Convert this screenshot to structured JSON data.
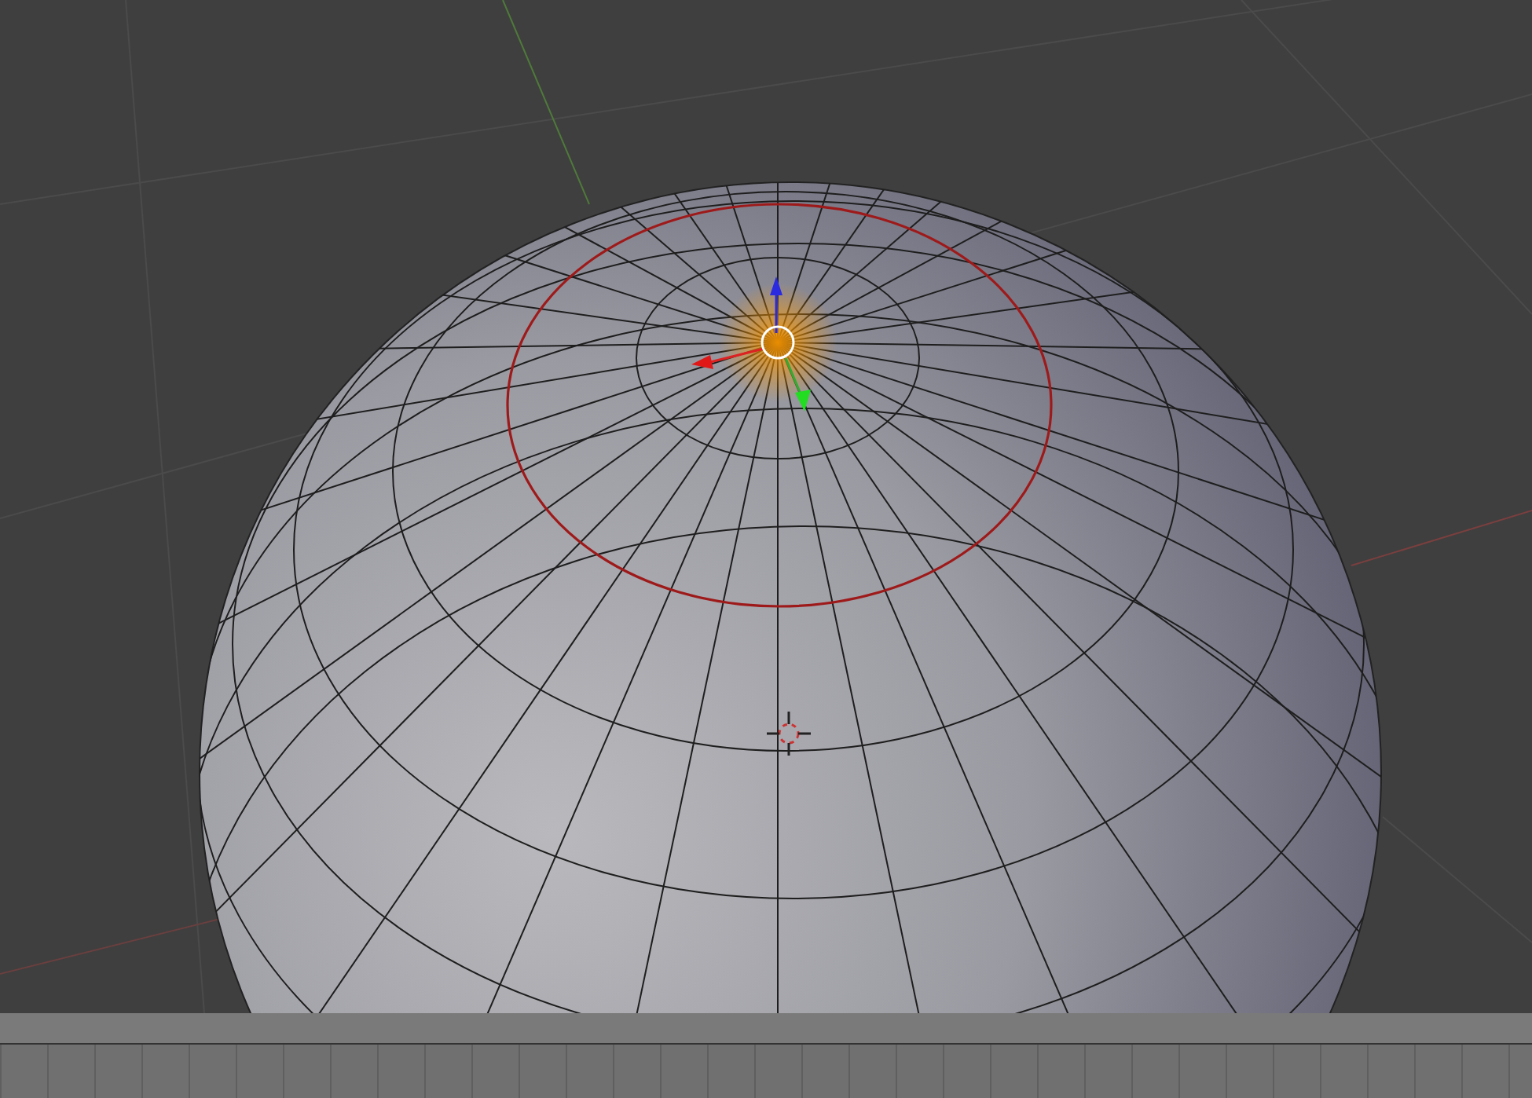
{
  "viewport": {
    "selected_loop": true
  }
}
